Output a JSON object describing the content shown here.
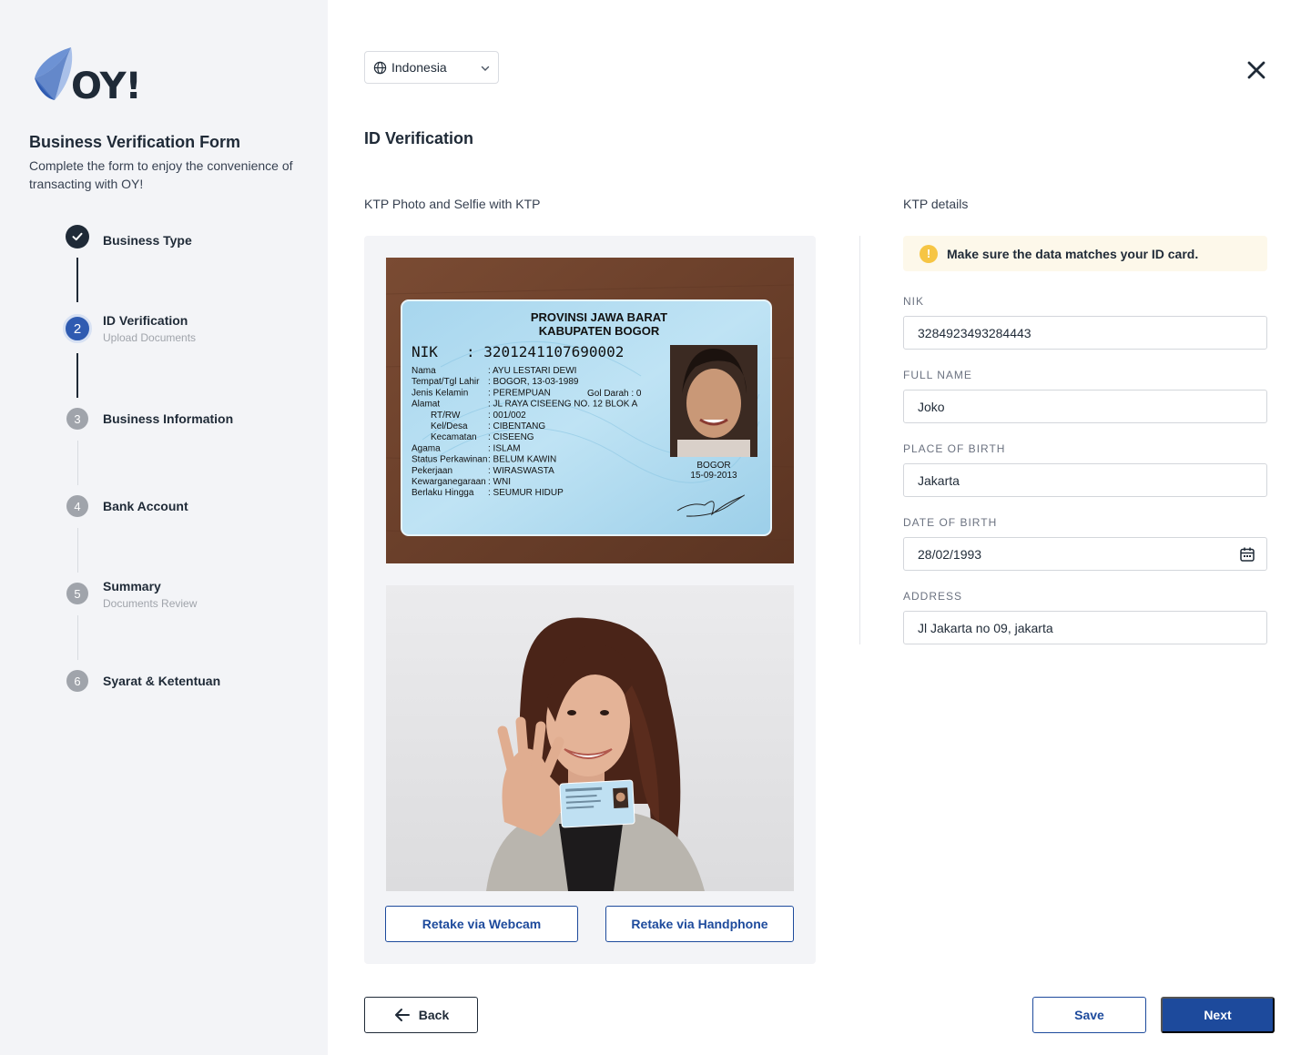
{
  "brand": {
    "logo_text": "OY!",
    "accent": "#1d4a9c",
    "logo_blue": "#2f5bb1"
  },
  "sidebar": {
    "title": "Business Verification Form",
    "subtitle": "Complete the form to enjoy the convenience of transacting with OY!",
    "steps": [
      {
        "number": "1",
        "label": "Business Type",
        "sub": "",
        "state": "done"
      },
      {
        "number": "2",
        "label": "ID Verification",
        "sub": "Upload Documents",
        "state": "active"
      },
      {
        "number": "3",
        "label": "Business Information",
        "sub": "",
        "state": "pending"
      },
      {
        "number": "4",
        "label": "Bank Account",
        "sub": "",
        "state": "pending"
      },
      {
        "number": "5",
        "label": "Summary",
        "sub": "Documents Review",
        "state": "pending"
      },
      {
        "number": "6",
        "label": "Syarat & Ketentuan",
        "sub": "",
        "state": "pending"
      }
    ]
  },
  "header": {
    "language": "Indonesia",
    "language_icon": "globe-icon",
    "close_icon": "close-icon"
  },
  "main": {
    "title": "ID Verification",
    "photos_section_label": "KTP Photo and Selfie with KTP",
    "details_section_label": "KTP details",
    "retake_webcam": "Retake via Webcam",
    "retake_handphone": "Retake via Handphone",
    "ktp_card": {
      "province": "PROVINSI JAWA BARAT",
      "regency": "KABUPATEN BOGOR",
      "nik_label": "NIK",
      "nik": ": 3201241107690002",
      "rows": [
        [
          "Nama",
          ": AYU LESTARI DEWI"
        ],
        [
          "Tempat/Tgl Lahir",
          ": BOGOR, 13-03-1989"
        ],
        [
          "Jenis Kelamin",
          ": PEREMPUAN"
        ],
        [
          "Alamat",
          ": JL RAYA CISEENG NO. 12 BLOK A"
        ],
        [
          "RT/RW",
          ": 001/002"
        ],
        [
          "Kel/Desa",
          ": CIBENTANG"
        ],
        [
          "Kecamatan",
          ": CISEENG"
        ],
        [
          "Agama",
          ": ISLAM"
        ],
        [
          "Status Perkawinan",
          ": BELUM KAWIN"
        ],
        [
          "Pekerjaan",
          ": WIRASWASTA"
        ],
        [
          "Kewarganegaraan",
          ": WNI"
        ],
        [
          "Berlaku Hingga",
          ": SEUMUR HIDUP"
        ]
      ],
      "blood_type": "Gol Darah   :  0",
      "issued_city": "BOGOR",
      "issued_date": "15-09-2013"
    },
    "alert": "Make sure the data matches your ID card.",
    "fields": {
      "nik": {
        "label": "NIK",
        "value": "3284923493284443"
      },
      "full_name": {
        "label": "FULL NAME",
        "value": "Joko"
      },
      "place_of_birth": {
        "label": "PLACE OF BIRTH",
        "value": "Jakarta"
      },
      "date_of_birth": {
        "label": "DATE OF BIRTH",
        "value": "28/02/1993"
      },
      "address": {
        "label": "ADDRESS",
        "value": "Jl Jakarta no 09, jakarta"
      }
    }
  },
  "footer": {
    "back": "Back",
    "save": "Save",
    "next": "Next"
  }
}
